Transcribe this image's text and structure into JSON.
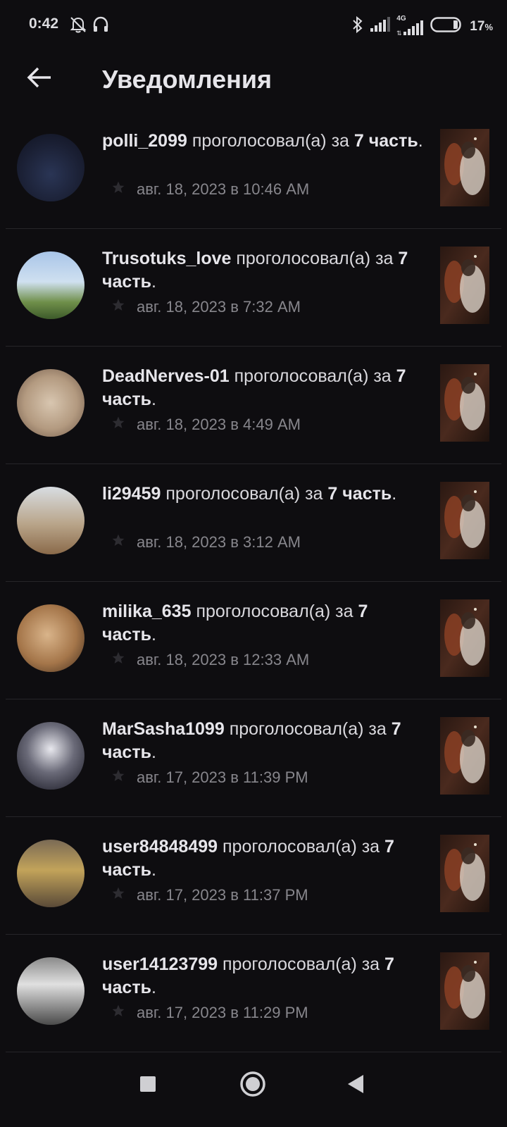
{
  "status_bar": {
    "time": "0:42",
    "network": "4G",
    "battery": "17",
    "battery_unit": "%"
  },
  "header": {
    "title": "Уведомления"
  },
  "notifications": [
    {
      "user": "polli_2099",
      "action": "проголосовал(а) за",
      "part": "7 часть",
      "date": "авг. 18, 2023 в 10:46 AM"
    },
    {
      "user": "Trusotuks_love",
      "action": "проголосовал(а) за",
      "part": "7 часть",
      "date": "авг. 18, 2023 в 7:32 AM"
    },
    {
      "user": "DeadNerves-01",
      "action": "проголосовал(а) за",
      "part": "7 часть",
      "date": "авг. 18, 2023 в 4:49 AM"
    },
    {
      "user": "li29459",
      "action": "проголосовал(а) за",
      "part": "7 часть",
      "date": "авг. 18, 2023 в 3:12 AM"
    },
    {
      "user": "milika_635",
      "action": "проголосовал(а) за",
      "part": "7 часть",
      "date": "авг. 18, 2023 в 12:33 AM"
    },
    {
      "user": "MarSasha1099",
      "action": "проголосовал(а) за",
      "part": "7 часть",
      "date": "авг. 17, 2023 в 11:39 PM"
    },
    {
      "user": "user84848499",
      "action": "проголосовал(а) за",
      "part": "7 часть",
      "date": "авг. 17, 2023 в 11:37 PM"
    },
    {
      "user": "user14123799",
      "action": "проголосовал(а) за",
      "part": "7 часть",
      "date": "авг. 17, 2023 в 11:29 PM"
    }
  ],
  "icons": {
    "back": "back-arrow-icon",
    "star": "star-icon",
    "nav_recent": "square-icon",
    "nav_home": "circle-icon",
    "nav_back": "triangle-back-icon"
  },
  "colors": {
    "background": "#0e0d10",
    "text_primary": "#e6e5ea",
    "text_secondary": "#87868c",
    "divider": "#262529"
  }
}
